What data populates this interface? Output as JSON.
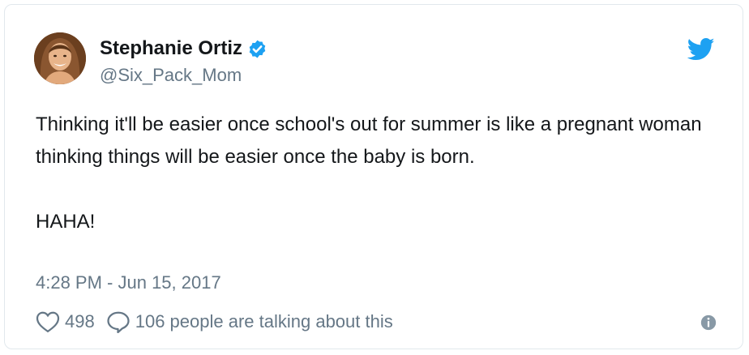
{
  "tweet": {
    "display_name": "Stephanie Ortiz",
    "handle": "@Six_Pack_Mom",
    "text": "Thinking it'll be easier once school's out for summer is like a pregnant woman thinking things will be easier once the baby is born.\n\nHAHA!",
    "timestamp": "4:28 PM - Jun 15, 2017",
    "like_count": "498",
    "talking_text": "106 people are talking about this"
  },
  "icons": {
    "verified": "verified-badge-icon",
    "brand": "twitter-bird-icon",
    "like": "heart-icon",
    "reply": "speech-bubble-icon",
    "info": "info-icon"
  },
  "colors": {
    "accent": "#1da1f2",
    "text": "#14171a",
    "muted": "#657786",
    "border": "#e1e8ed"
  }
}
